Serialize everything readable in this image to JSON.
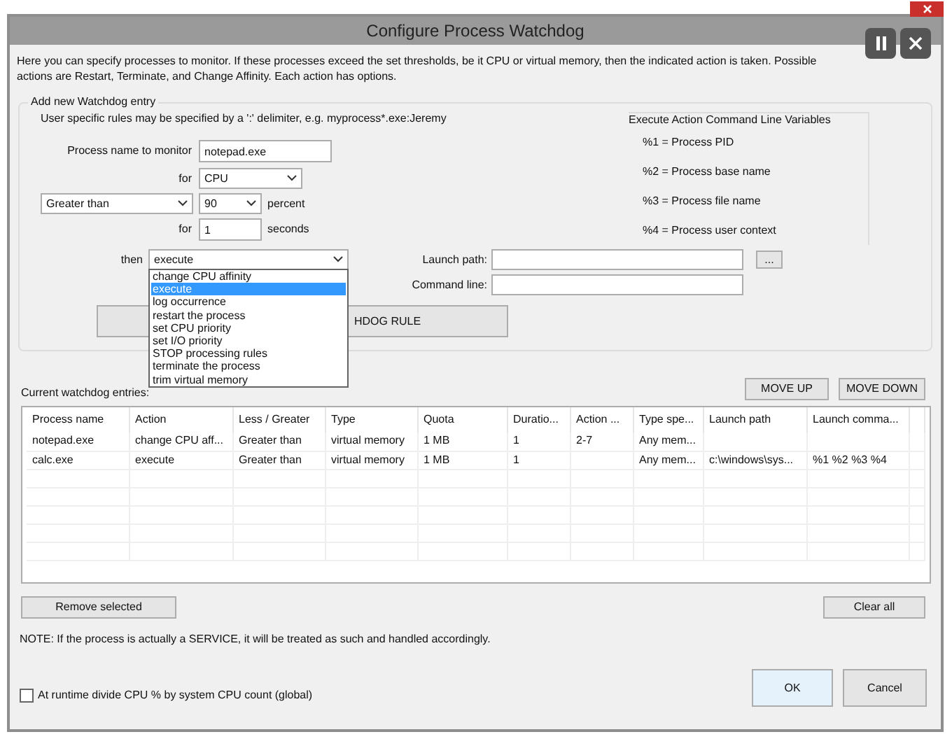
{
  "window": {
    "title": "Configure Process Watchdog"
  },
  "description": "Here you can specify processes to monitor. If these processes exceed the set thresholds, be it CPU or virtual memory, then the indicated action is taken. Possible actions are Restart, Terminate, and Change Affinity. Each action has options.",
  "add_entry": {
    "group_title": "Add new Watchdog entry",
    "hint": "User specific rules may be specified by a ':' delimiter, e.g. myprocess*.exe:Jeremy",
    "process_label": "Process name to monitor",
    "process_name": "notepad.exe",
    "for_label": "for",
    "resource": "CPU",
    "comparison": "Greater than",
    "threshold": "90",
    "threshold_unit": "percent",
    "duration_label": "for",
    "duration": "1",
    "duration_unit": "seconds",
    "then_label": "then",
    "action": "execute",
    "action_options": [
      {
        "label": "change CPU affinity",
        "selected": false
      },
      {
        "label": "execute",
        "selected": true
      },
      {
        "label": "log occurrence",
        "selected": false
      },
      {
        "label": "restart the process",
        "selected": false
      },
      {
        "label": "set CPU priority",
        "selected": false
      },
      {
        "label": "set I/O priority",
        "selected": false
      },
      {
        "label": "STOP processing rules",
        "selected": false
      },
      {
        "label": "terminate the process",
        "selected": false
      },
      {
        "label": "trim virtual memory",
        "selected": false
      }
    ],
    "launch_path_label": "Launch path:",
    "browse_button": "...",
    "command_line_label": "Command line:",
    "add_button": "HDOG RULE"
  },
  "variables": {
    "title": "Execute Action Command Line Variables",
    "items": [
      "%1 = Process PID",
      "%2 = Process base name",
      "%3 = Process file name",
      "%4 = Process user context"
    ]
  },
  "entries": {
    "label": "Current watchdog entries:",
    "move_up": "MOVE UP",
    "move_down": "MOVE DOWN",
    "columns": [
      "Process name",
      "Action",
      "Less / Greater",
      "Type",
      "Quota",
      "Duratio...",
      "Action ...",
      "Type spe...",
      "Launch path",
      "Launch comma..."
    ],
    "rows": [
      [
        "notepad.exe",
        "change CPU aff...",
        "Greater than",
        "virtual memory",
        "1 MB",
        "1",
        "2-7",
        "Any mem...",
        null,
        null
      ],
      [
        "calc.exe",
        "execute",
        "Greater than",
        "virtual memory",
        "1 MB",
        "1",
        null,
        "Any mem...",
        "c:\\windows\\sys...",
        "%1 %2 %3 %4"
      ]
    ]
  },
  "remove_button": "Remove selected",
  "clear_button": "Clear all",
  "note": "NOTE: If the process is actually a SERVICE, it will be treated as such and handled accordingly.",
  "runtime_option": {
    "label": "At runtime divide CPU % by system CPU count (global)",
    "checked": false
  },
  "ok_button": "OK",
  "cancel_button": "Cancel"
}
